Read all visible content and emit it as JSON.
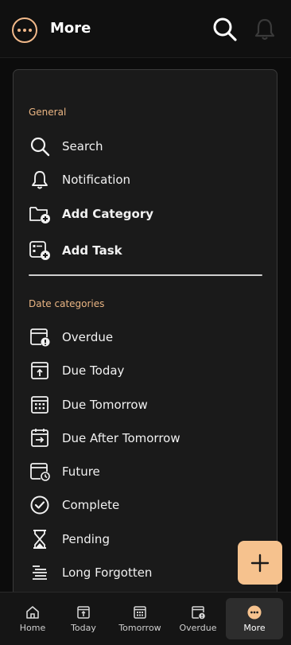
{
  "header": {
    "title": "More",
    "logo_icon": "more-dots-icon",
    "search_icon": "search-icon",
    "bell_icon": "bell-icon"
  },
  "sections": {
    "general": {
      "title": "General",
      "items": [
        {
          "label": "Search",
          "icon": "search-icon"
        },
        {
          "label": "Notification",
          "icon": "bell-icon"
        },
        {
          "label": "Add Category",
          "icon": "folder-add-icon"
        },
        {
          "label": "Add Task",
          "icon": "task-add-icon"
        }
      ]
    },
    "dates": {
      "title": "Date categories",
      "items": [
        {
          "label": "Overdue",
          "icon": "calendar-alert-icon"
        },
        {
          "label": "Due Today",
          "icon": "calendar-today-icon"
        },
        {
          "label": "Due Tomorrow",
          "icon": "calendar-grid-icon"
        },
        {
          "label": "Due After Tomorrow",
          "icon": "calendar-arrow-icon"
        },
        {
          "label": "Future",
          "icon": "calendar-clock-icon"
        },
        {
          "label": "Complete",
          "icon": "check-circle-icon"
        },
        {
          "label": "Pending",
          "icon": "hourglass-icon"
        },
        {
          "label": "Long Forgotten",
          "icon": "lines-icon"
        }
      ]
    }
  },
  "fab": {
    "icon": "plus-icon"
  },
  "bottom_nav": [
    {
      "label": "Home",
      "icon": "home-icon"
    },
    {
      "label": "Today",
      "icon": "calendar-today-icon"
    },
    {
      "label": "Tomorrow",
      "icon": "calendar-grid-icon"
    },
    {
      "label": "Overdue",
      "icon": "calendar-alert-icon"
    },
    {
      "label": "More",
      "icon": "more-dots-icon",
      "active": true
    }
  ],
  "colors": {
    "accent": "#f2b98a",
    "fab": "#f6c28e",
    "section_title": "#eab583",
    "panel_bg": "#1a1a1a",
    "background": "#0c0c0c"
  }
}
